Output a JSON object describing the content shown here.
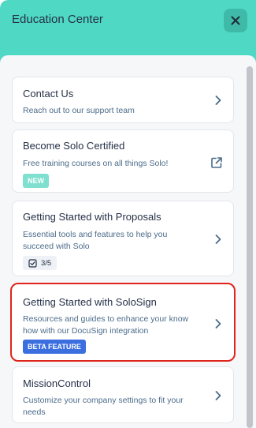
{
  "header": {
    "title": "Education Center",
    "close_icon": "close-icon"
  },
  "cards": [
    {
      "title": "Contact Us",
      "description": "Reach out to our support team",
      "action_icon": "chevron-right-icon"
    },
    {
      "title": "Become Solo Certified",
      "description": "Free training courses on all things Solo!",
      "badge": "NEW",
      "action_icon": "external-link-icon"
    },
    {
      "title": "Getting Started with Proposals",
      "description": "Essential tools and features to help you succeed with Solo",
      "progress": "3/5",
      "progress_icon": "checkbox-icon",
      "action_icon": "chevron-right-icon"
    },
    {
      "title": "Getting Started with SoloSign",
      "description": "Resources and guides to enhance your know how with our DocuSign integration",
      "badge": "BETA FEATURE",
      "action_icon": "chevron-right-icon",
      "highlight_color": "#e0241b"
    },
    {
      "title": "MissionControl",
      "description": "Customize your company settings to fit your needs",
      "action_icon": "chevron-right-icon"
    }
  ],
  "colors": {
    "header_bg": "#4fd8c4",
    "close_bg": "#3fb9a8",
    "new_badge": "#7fe0cf",
    "beta_badge": "#3b6fe0",
    "highlight": "#e0241b"
  }
}
